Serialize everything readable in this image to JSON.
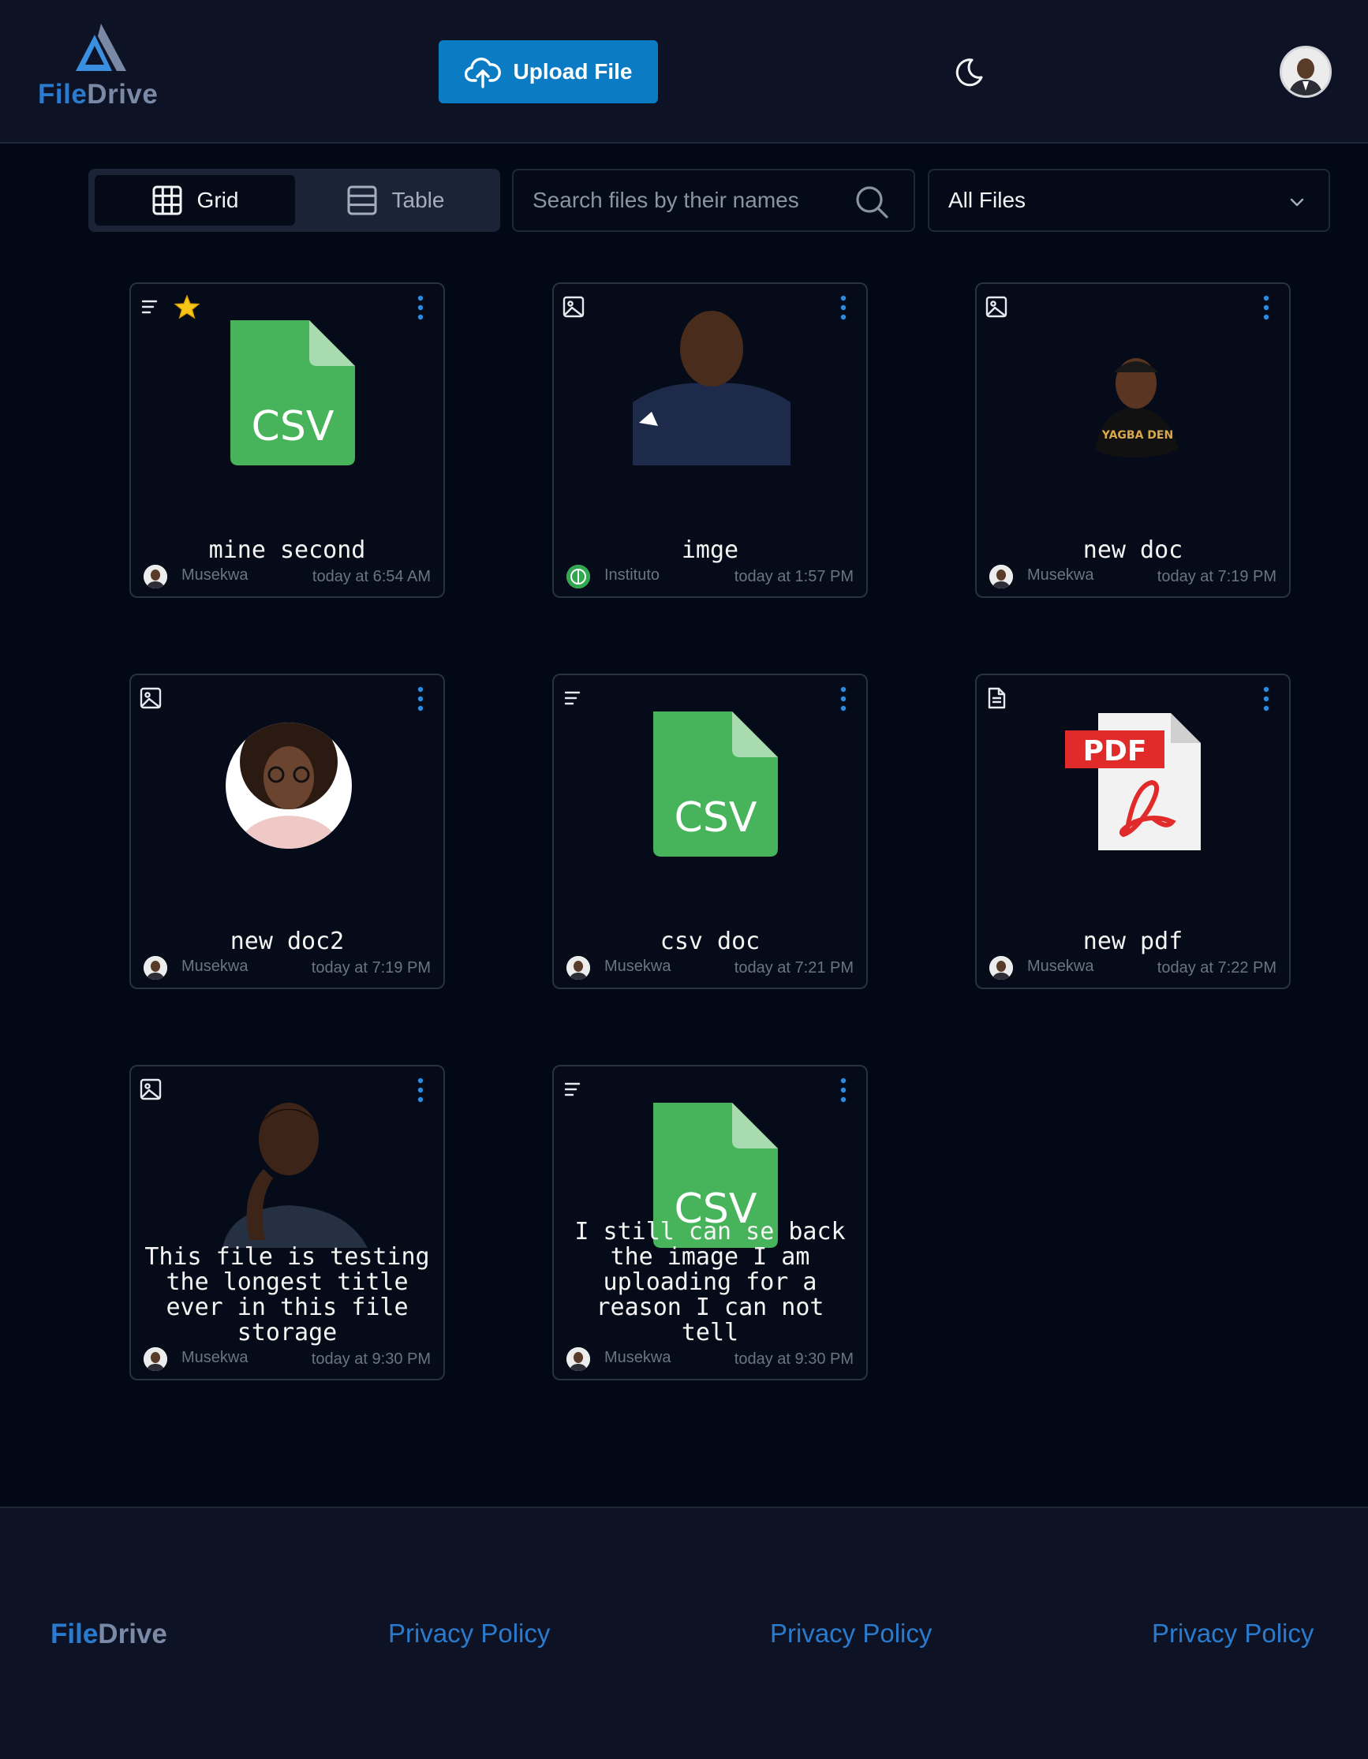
{
  "header": {
    "logo_file": "File",
    "logo_drive": "Drive",
    "upload_label": "Upload File",
    "theme_icon": "moon-icon"
  },
  "toolbar": {
    "grid_label": "Grid",
    "table_label": "Table",
    "search_placeholder": "Search files by their names",
    "filter_value": "All Files"
  },
  "files": [
    {
      "title": "mine second",
      "owner": "Musekwa",
      "date": "today at 6:54 AM",
      "type": "csv",
      "favorite": true
    },
    {
      "title": "imge",
      "owner": "Instituto",
      "date": "today at 1:57 PM",
      "type": "image"
    },
    {
      "title": "new doc",
      "owner": "Musekwa",
      "date": "today at 7:19 PM",
      "type": "image"
    },
    {
      "title": "new doc2",
      "owner": "Musekwa",
      "date": "today at 7:19 PM",
      "type": "image"
    },
    {
      "title": "csv doc",
      "owner": "Musekwa",
      "date": "today at 7:21 PM",
      "type": "csv"
    },
    {
      "title": "new pdf",
      "owner": "Musekwa",
      "date": "today at 7:22 PM",
      "type": "pdf"
    },
    {
      "title": "This file is testing\nthe longest title\never in this file\nstorage",
      "owner": "Musekwa",
      "date": "today at 9:30 PM",
      "type": "image"
    },
    {
      "title": "I still can se back\nthe image I am\nuploading for a\nreason I can not\ntell",
      "owner": "Musekwa",
      "date": "today at 9:30 PM",
      "type": "csv"
    }
  ],
  "thumb_text": {
    "csv": "CSV",
    "pdf": "PDF"
  },
  "footer": {
    "logo_file": "File",
    "logo_drive": "Drive",
    "links": [
      "Privacy Policy",
      "Privacy Policy",
      "Privacy Policy"
    ]
  },
  "colors": {
    "accent": "#0b7bc4",
    "csv_green": "#47b35a",
    "pdf_red": "#e12b2b",
    "star": "#f5c518"
  }
}
